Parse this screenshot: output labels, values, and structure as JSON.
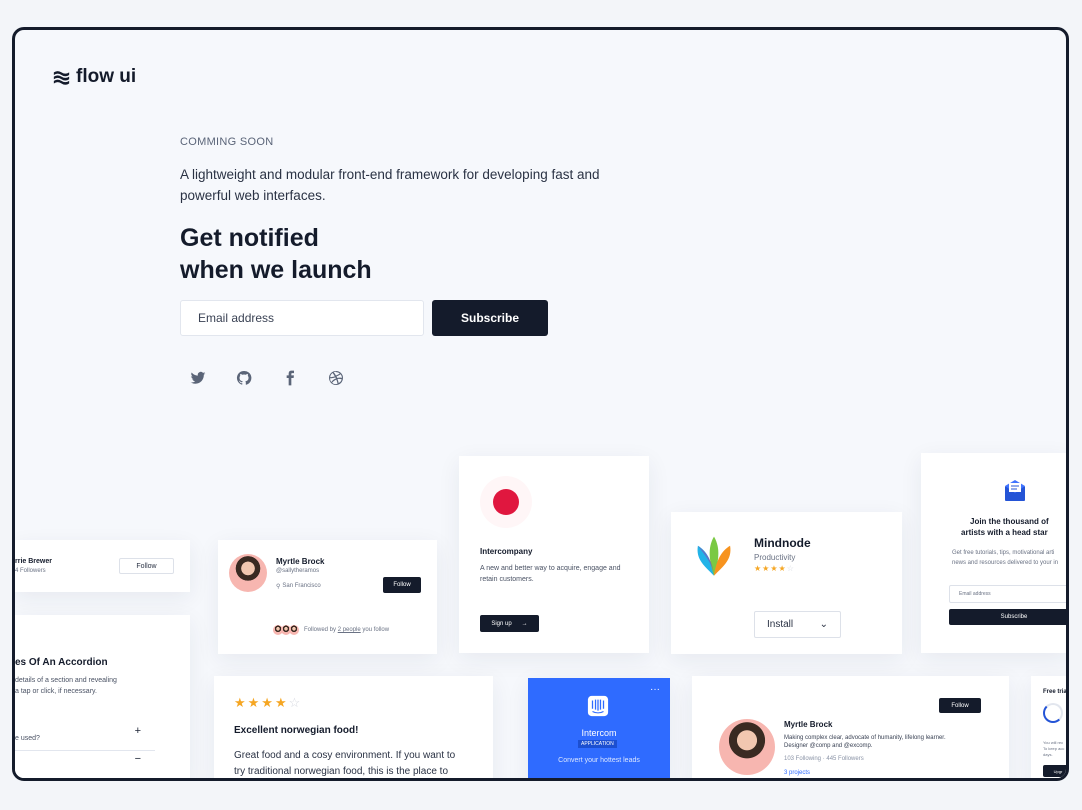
{
  "brand": {
    "name": "flow ui"
  },
  "hero": {
    "eyebrow": "COMMING SOON",
    "lead": "A lightweight and modular front-end framework for developing fast and powerful web interfaces.",
    "headline_1": "Get notified",
    "headline_2": "when we launch",
    "email_placeholder": "Email address",
    "subscribe_label": "Subscribe"
  },
  "socials": [
    "twitter-icon",
    "github-icon",
    "facebook-icon",
    "dribbble-icon"
  ],
  "cards": {
    "follow_partial": {
      "name": "rrie Brewer",
      "followers": "4 Followers",
      "follow": "Follow"
    },
    "accordion": {
      "title": "es Of An Accordion",
      "desc_1": "details of a section and revealing",
      "desc_2": "a tap or click, if necessary.",
      "item_1": "e used?",
      "item_2": ""
    },
    "profile": {
      "name": "Myrtle Brock",
      "handle": "@sallytheramos",
      "location": "San Francisco",
      "follow": "Follow",
      "followed_prefix": "Followed by ",
      "followed_link": "2 people",
      "followed_suffix": " you follow"
    },
    "intercompany": {
      "title": "Intercompany",
      "desc": "A new and better way to acquire, engage and retain customers.",
      "cta": "Sign up"
    },
    "mindnode": {
      "title": "Mindnode",
      "category": "Productivity",
      "rating": 4,
      "install": "Install"
    },
    "newsletter": {
      "title_1": "Join the thousand of",
      "title_2": "artists with a head star",
      "desc_1": "Get free tutorials, tips, motivational arti",
      "desc_2": "news and resources delivered to your in",
      "email_placeholder": "Email address",
      "subscribe": "Subscribe"
    },
    "review": {
      "rating": 4,
      "title": "Excellent norwegian food!",
      "body_1": "Great food and a cosy environment. If you want to",
      "body_2": "try traditional norwegian food, this is the place to"
    },
    "intercom": {
      "title": "Intercom",
      "badge": "APPLICATION",
      "desc": "Convert your hottest leads",
      "menu": "···"
    },
    "profile2": {
      "name": "Myrtle Brock",
      "bio_1": "Making complex clear, advocate of humanity, lifelong learner.",
      "bio_2": "Designer @comp and @excomp.",
      "stats": "103 Following · 445 Followers",
      "projects": "3 projects",
      "follow": "Follow"
    },
    "trial": {
      "title": "Free trial",
      "line_1": "You will rec",
      "line_2": "To keep acc",
      "line_3": "days.",
      "btn": "Upgr"
    }
  },
  "colors": {
    "dark": "#141b2b",
    "accent_red": "#e0173f",
    "intercom_blue": "#2f6bff",
    "star": "#f5a623"
  }
}
